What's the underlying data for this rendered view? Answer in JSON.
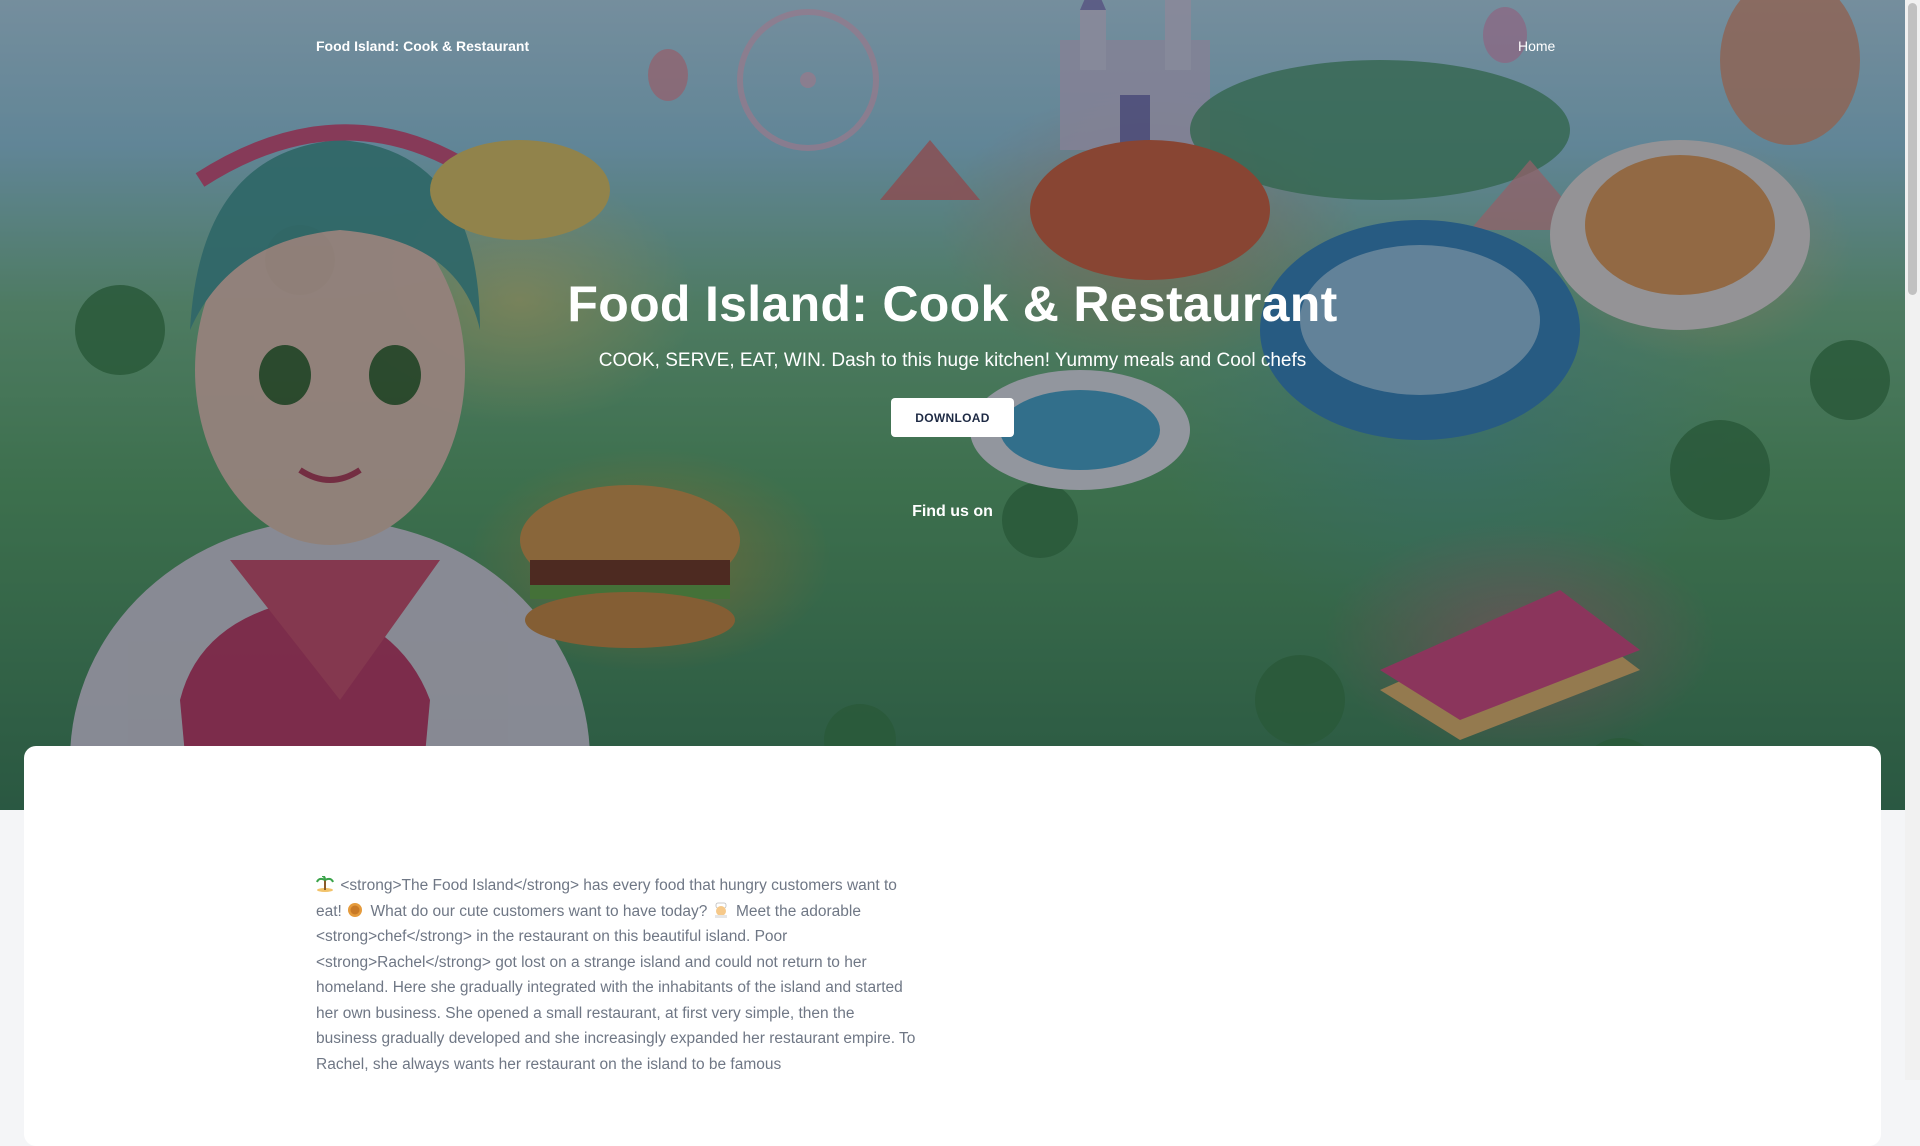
{
  "navbar": {
    "brand": "Food Island: Cook & Restaurant",
    "home_link": "Home"
  },
  "hero": {
    "title": "Food Island: Cook & Restaurant",
    "subtitle": "COOK, SERVE, EAT, WIN. Dash to this huge kitchen! Yummy meals and Cool chefs",
    "download_label": "DOWNLOAD",
    "find_us_label": "Find us on",
    "background_image": "island-cook-game-artwork"
  },
  "description": {
    "segment_1": "<strong>The Food Island</strong> has every food that hungry customers want to eat!",
    "segment_2": "What do our cute customers want to have today?",
    "segment_3": "Meet the adorable <strong>chef</strong> in the restaurant on this beautiful island. Poor <strong>Rachel</strong> got lost on a strange island and could not return to her homeland. Here she gradually integrated with the inhabitants of the island and started her own business. She opened a small restaurant, at first very simple, then the business gradually developed and she increasingly expanded her restaurant empire. To Rachel, she always wants her restaurant on the island to be famous",
    "emoji_icons": [
      "island-emoji",
      "pie-emoji",
      "chef-emoji"
    ]
  },
  "colors": {
    "overlay": "#0f1423",
    "button_bg": "#ffffff",
    "button_text": "#1e2a44",
    "body_text": "#6f7785",
    "page_bg": "#f4f5f7"
  }
}
